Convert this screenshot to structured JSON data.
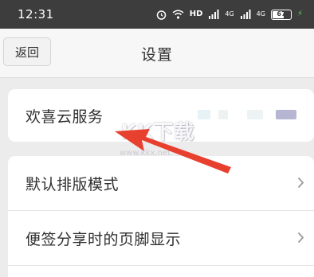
{
  "status_bar": {
    "time": "12:31",
    "network_label": "HD",
    "signal_1_label": "4G",
    "signal_2_label": "4G",
    "battery_level": "67",
    "icons": [
      "alarm-icon",
      "wifi-icon",
      "signal-icon",
      "battery-icon",
      "charging-icon"
    ]
  },
  "header": {
    "back_label": "返回",
    "title": "设置"
  },
  "settings": {
    "cloud_service_label": "欢喜云服务",
    "items": [
      {
        "label": "默认排版模式",
        "icon": "chevron-right-icon"
      },
      {
        "label": "便签分享时的页脚显示",
        "icon": "chevron-right-icon"
      }
    ]
  },
  "watermark": {
    "text": "KK下载",
    "url": "www.kkx.net"
  },
  "colors": {
    "status_bar_bg": "#3d3d3d",
    "page_bg": "#ececec",
    "card_bg": "#ffffff",
    "arrow": "#e8402f",
    "charging": "#55d34c"
  }
}
